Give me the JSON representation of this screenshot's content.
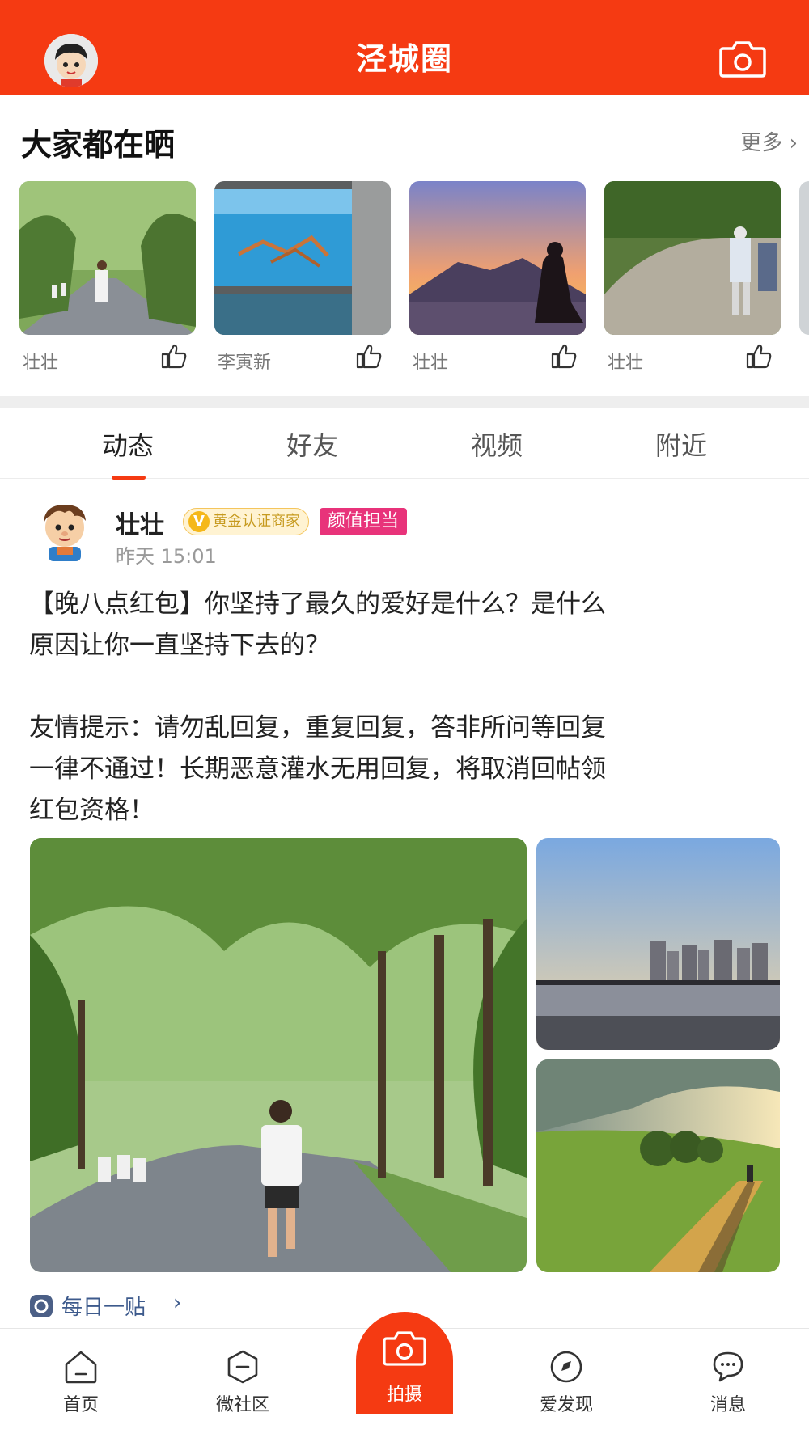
{
  "header": {
    "title": "泾城圈",
    "avatar_icon": "cartoon-avatar-icon",
    "camera_icon": "camera-icon"
  },
  "shared": {
    "title": "大家都在晒",
    "more": "更多 ›",
    "cards": [
      {
        "name": "壮壮",
        "scene": "tree-lined road runners"
      },
      {
        "name": "李寅新",
        "scene": "crabs in aquarium tank"
      },
      {
        "name": "壮壮",
        "scene": "meditation at sunset over mountain"
      },
      {
        "name": "壮壮",
        "scene": "two people walking on forest path"
      }
    ]
  },
  "tabs": [
    {
      "label": "动态",
      "active": true
    },
    {
      "label": "好友",
      "active": false
    },
    {
      "label": "视频",
      "active": false
    },
    {
      "label": "附近",
      "active": false
    }
  ],
  "post": {
    "author": "壮壮",
    "badge_gold": "黄金认证商家",
    "badge_gold_icon": "V",
    "badge_pink": "颜值担当",
    "time": "昨天 15:01",
    "text": "【晚八点红包】你坚持了最久的爱好是什么？是什么\n原因让你一直坚持下去的？\n\n友情提示：请勿乱回复，重复回复，答非所问等回复\n一律不通过！长期恶意灌水无用回复，将取消回帖领\n红包资格！",
    "topic": "每日一贴",
    "topic_arrow": "›"
  },
  "bottom_nav": [
    {
      "label": "首页",
      "icon": "home-icon"
    },
    {
      "label": "微社区",
      "icon": "community-icon"
    },
    {
      "label": "拍摄",
      "icon": "camera-icon"
    },
    {
      "label": "爱发现",
      "icon": "discover-icon"
    },
    {
      "label": "消息",
      "icon": "message-icon"
    }
  ],
  "colors": {
    "brand": "#f53a12",
    "gold_badge": "#f5b81a",
    "pink_badge": "#e8337a",
    "topic_link": "#3d5a8c"
  }
}
